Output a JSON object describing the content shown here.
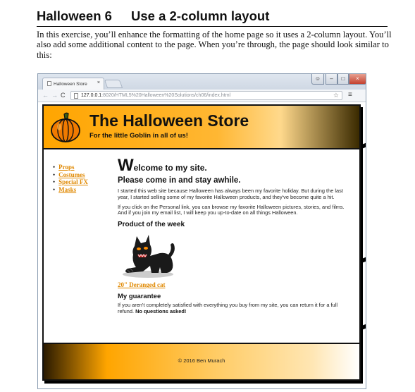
{
  "document": {
    "exercise_number": "Halloween 6",
    "exercise_title": "Use a 2-column layout",
    "intro": "In this exercise, you’ll enhance the formatting of the home page so it uses a 2-column layout. You’ll also add some additional content to the page. When you’re through, the page should look similar to this:"
  },
  "browser": {
    "tab_title": "Halloween Store",
    "tab_close": "×",
    "url_host": "127.0.0.1",
    "url_path": ":8020/HTML5%20Halloween%20Solutions/ch06/index.html",
    "window_buttons": {
      "user": "☺",
      "minimize": "–",
      "maximize": "□",
      "close": "×"
    },
    "icons": {
      "back": "←",
      "forward": "→",
      "reload": "C",
      "star": "☆",
      "menu": "≡"
    }
  },
  "site": {
    "title": "The Halloween Store",
    "tagline": "For the little Goblin in all of us!",
    "nav": [
      "Props",
      "Costumes",
      "Special FX",
      "Masks"
    ],
    "welcome_initial": "W",
    "welcome_rest": "elcome to my site.",
    "subheading": "Please come in and stay awhile.",
    "paragraph1": "I started this web site because Halloween has always been my favorite holiday. But during the last year, I started selling some of my favorite Halloween products, and they've become quite a hit.",
    "paragraph2": "If you click on the Personal link, you can browse my favorite Halloween pictures, stories, and films. And if you join my email list, I will keep you up-to-date on all things Halloween.",
    "product_heading": "Product of the week",
    "product_link": "20\" Deranged cat",
    "guarantee_heading": "My guarantee",
    "guarantee_text": "If you aren't completely satisfied with everything you buy from my site, you can return it for a full refund.",
    "guarantee_emphasis": "No questions asked!",
    "footer": "© 2016 Ben Murach"
  },
  "colors": {
    "orange": "#ffa500",
    "link": "#e08800",
    "chrome": "#dfe6ef"
  }
}
